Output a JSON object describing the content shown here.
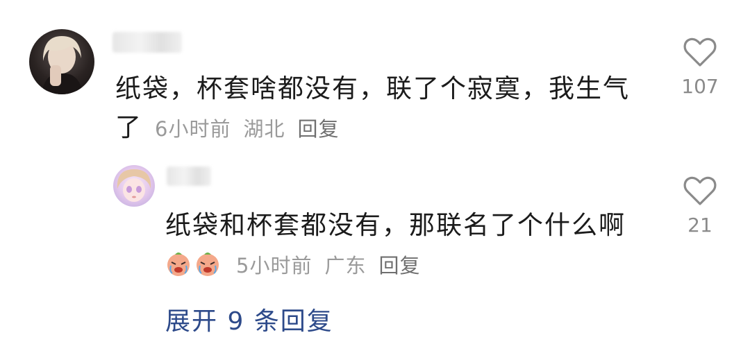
{
  "comment": {
    "text": "纸袋，杯套啥都没有，联了个寂寞，我生气了",
    "time": "6小时前",
    "location": "湖北",
    "reply_label": "回复",
    "likes": "107"
  },
  "reply": {
    "text": "纸袋和杯套都没有，那联名了个什么啊",
    "time": "5小时前",
    "location": "广东",
    "reply_label": "回复",
    "likes": "21"
  },
  "expand_label": "展开 9 条回复",
  "icons": {
    "like": "heart-outline-icon",
    "emoji": "crying-face-emoji"
  }
}
